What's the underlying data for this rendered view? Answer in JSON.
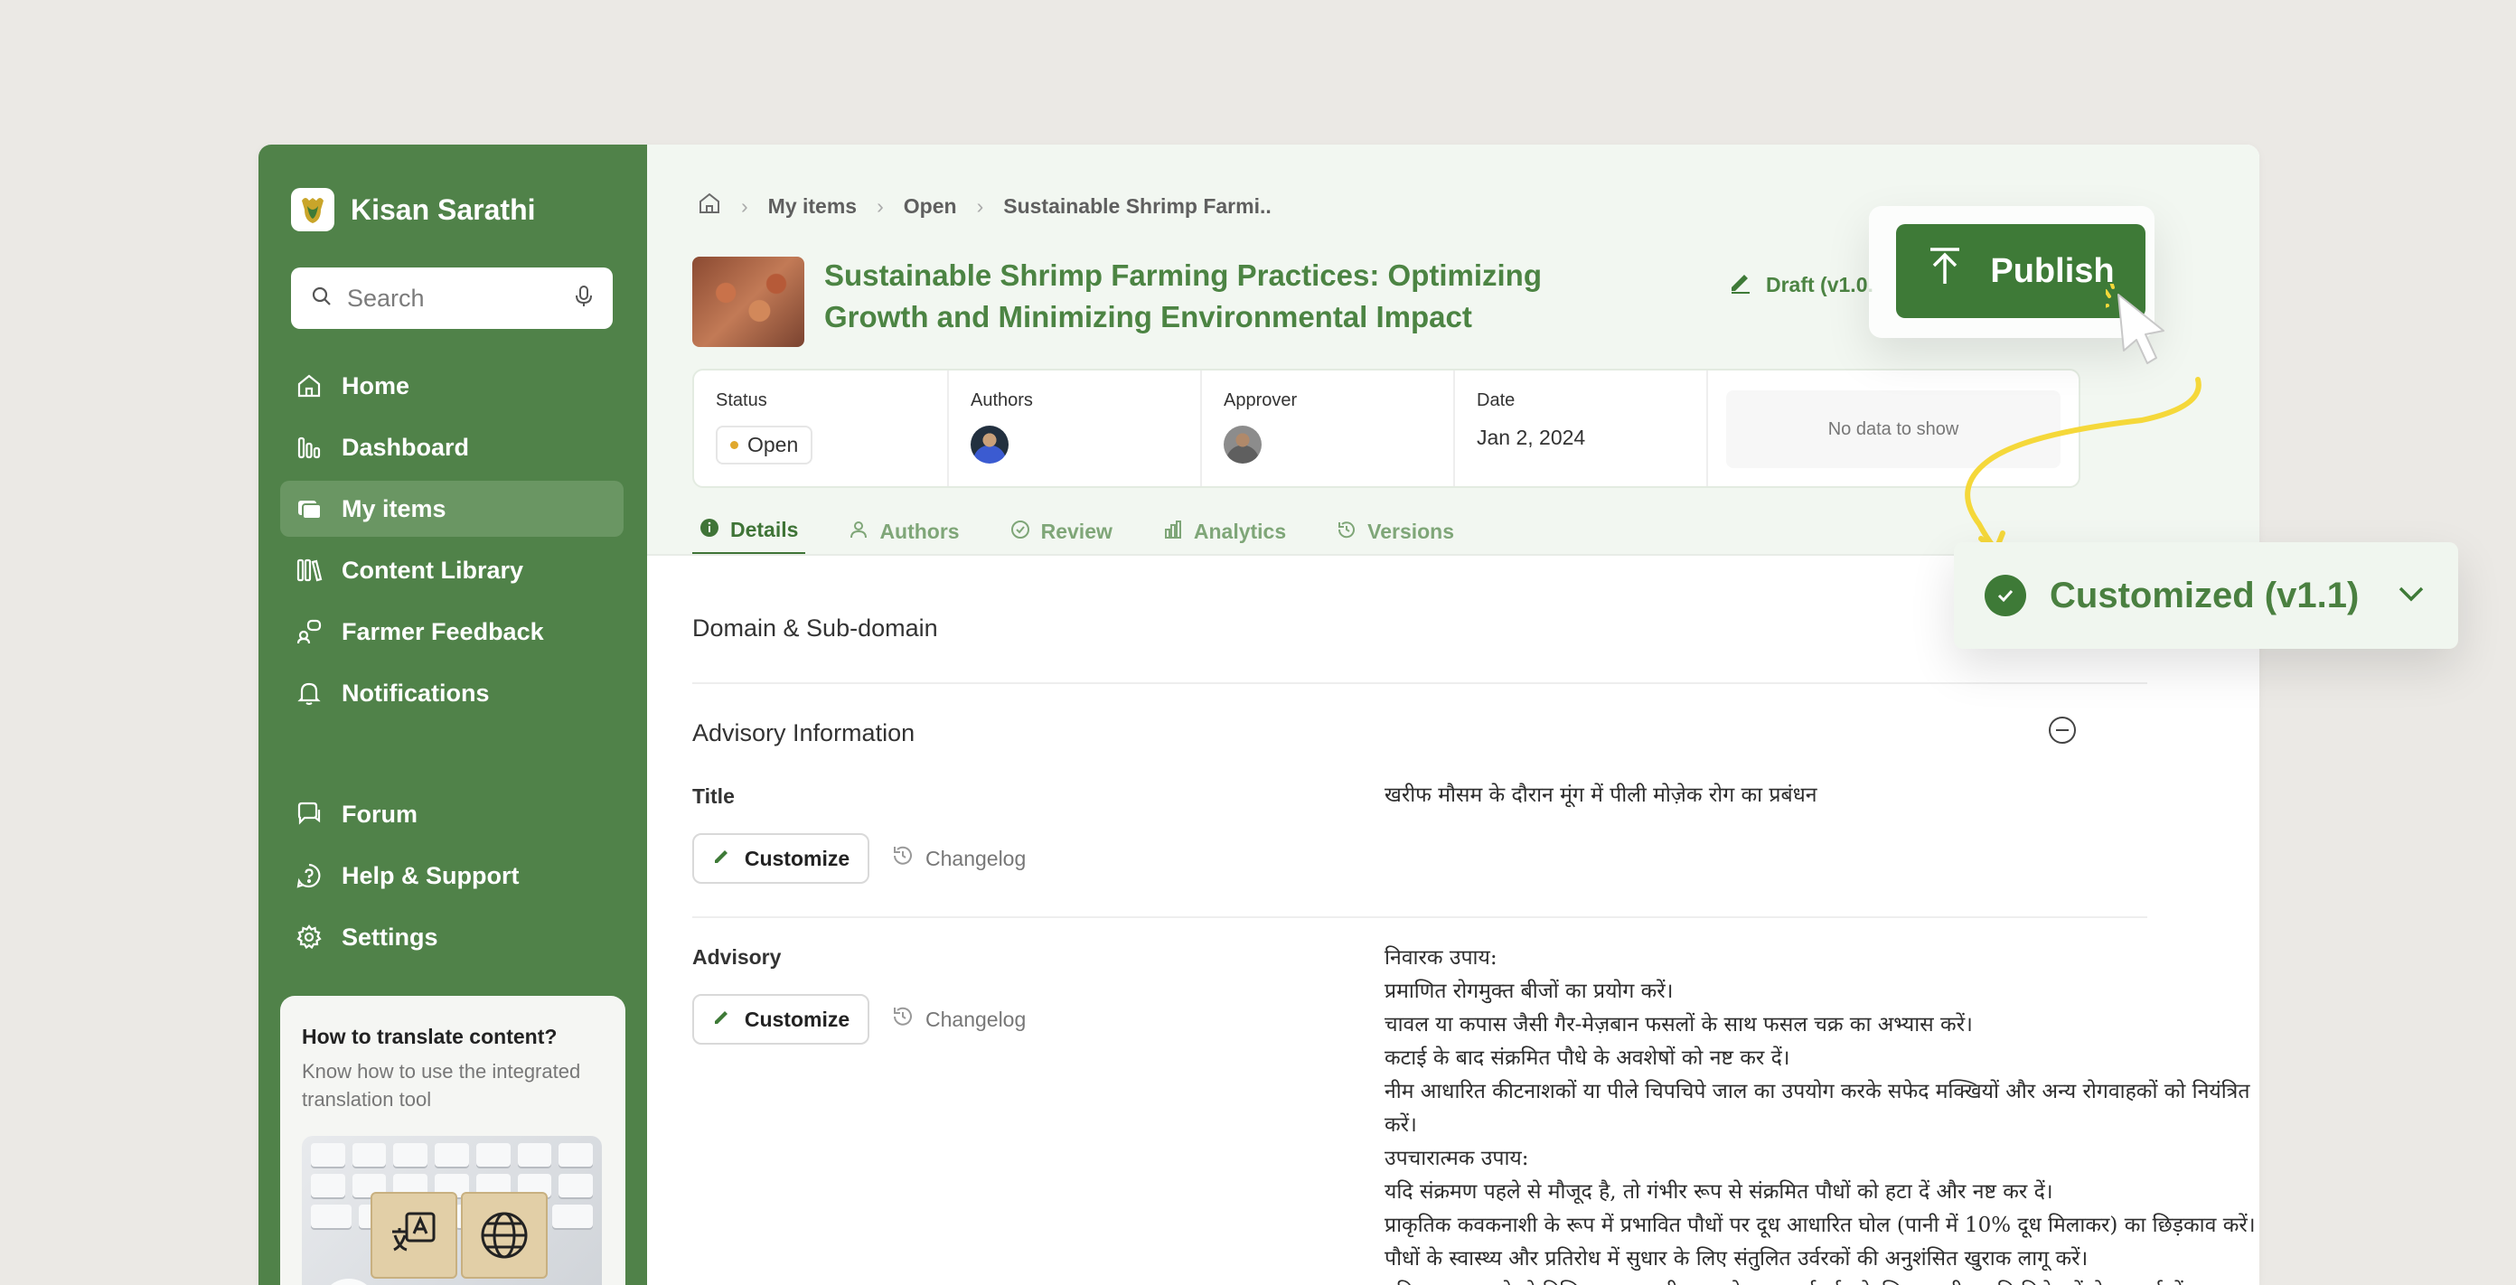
{
  "brand": {
    "name": "Kisan Sarathi",
    "logo_icon": "brand-logo-icon"
  },
  "search": {
    "placeholder": "Search"
  },
  "nav": {
    "home": "Home",
    "dashboard": "Dashboard",
    "my_items": "My items",
    "content_library": "Content Library",
    "farmer_feedback": "Farmer Feedback",
    "notifications": "Notifications",
    "forum": "Forum",
    "help_support": "Help & Support",
    "settings": "Settings"
  },
  "help_card": {
    "title": "How to translate content?",
    "description": "Know how to use the integrated translation tool"
  },
  "breadcrumb": {
    "items": [
      "My items",
      "Open",
      "Sustainable Shrimp Farmi.."
    ]
  },
  "item": {
    "title": "Sustainable Shrimp Farming Practices: Optimizing Growth and Minimizing Environmental Impact",
    "draft_label": "Draft (v1.0."
  },
  "meta": {
    "status_label": "Status",
    "status_value": "Open",
    "authors_label": "Authors",
    "approver_label": "Approver",
    "date_label": "Date",
    "date_value": "Jan 2, 2024",
    "no_data": "No data to show"
  },
  "tabs": [
    "Details",
    "Authors",
    "Review",
    "Analytics",
    "Versions"
  ],
  "sections": {
    "domain": "Domain & Sub-domain",
    "advisory_info": "Advisory Information"
  },
  "fields": {
    "title_label": "Title",
    "title_value": "खरीफ मौसम के दौरान मूंग में पीली मोज़ेक रोग का प्रबंधन",
    "advisory_label": "Advisory",
    "customize": "Customize",
    "changelog": "Changelog",
    "advisory_lines": [
      "निवारक उपाय:",
      "प्रमाणित रोगमुक्त बीजों का प्रयोग करें।",
      "चावल या कपास जैसी गैर-मेज़बान फसलों के साथ फसल चक्र का अभ्यास करें।",
      "कटाई के बाद संक्रमित पौधे के अवशेषों को नष्ट कर दें।",
      "नीम आधारित कीटनाशकों या पीले चिपचिपे जाल का उपयोग करके सफेद मक्खियों और अन्य रोगवाहकों को नियंत्रित करें।",
      "उपचारात्मक उपाय:",
      "यदि संक्रमण पहले से मौजूद है, तो गंभीर रूप से संक्रमित पौधों को हटा दें और नष्ट कर दें।",
      "प्राकृतिक कवकनाशी के रूप में प्रभावित पौधों पर दूध आधारित घोल (पानी में 10% दूध मिलाकर) का छिड़काव करें।",
      "पौधों के स्वास्थ्य और प्रतिरोध में सुधार के लिए संतुलित उर्वरकों की अनुशंसित खुराक लागू करें।",
      "यदि आवश्यक हो तो विशिष्ट कवकनाशी अनुप्रयोग पर मार्गदर्शन के लिए स्थानीय कृषि विशेषज्ञों से परामर्श लें।"
    ]
  },
  "publish": {
    "label": "Publish"
  },
  "version_dropdown": {
    "label": "Customized (v1.1)"
  },
  "colors": {
    "sidebar": "#508249",
    "accent": "#3e7a37",
    "highlight_curve": "#f5d83a"
  }
}
